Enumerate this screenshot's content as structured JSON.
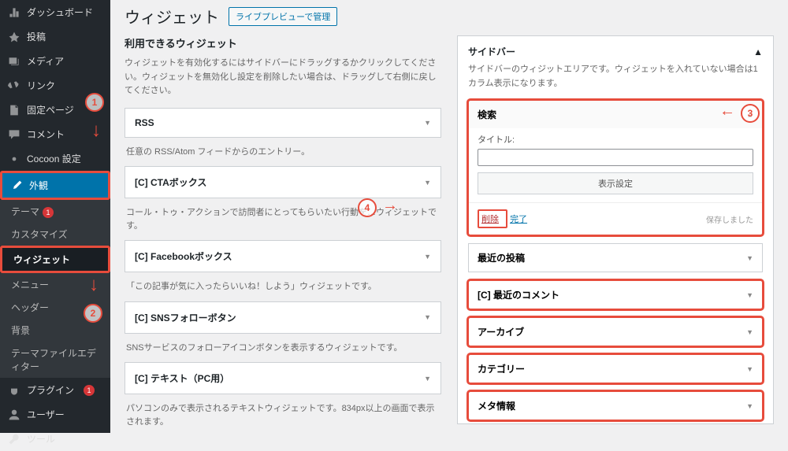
{
  "header": {
    "title": "ウィジェット",
    "liveBtn": "ライブプレビューで管理"
  },
  "sidebar": {
    "items": [
      {
        "label": "ダッシュボード",
        "icon": "dash"
      },
      {
        "label": "投稿",
        "icon": "pin"
      },
      {
        "label": "メディア",
        "icon": "media"
      },
      {
        "label": "リンク",
        "icon": "link"
      },
      {
        "label": "固定ページ",
        "icon": "page"
      },
      {
        "label": "コメント",
        "icon": "comment"
      },
      {
        "label": "Cocoon 設定",
        "icon": "gear"
      },
      {
        "label": "外観",
        "icon": "brush",
        "active": true
      },
      {
        "label": "プラグイン",
        "icon": "plug",
        "badge": "1"
      },
      {
        "label": "ユーザー",
        "icon": "user"
      },
      {
        "label": "ツール",
        "icon": "tool"
      }
    ],
    "appearanceSub": [
      {
        "label": "テーマ",
        "badge": "1"
      },
      {
        "label": "カスタマイズ"
      },
      {
        "label": "ウィジェット",
        "active": true
      },
      {
        "label": "メニュー"
      },
      {
        "label": "ヘッダー"
      },
      {
        "label": "背景"
      },
      {
        "label": "テーマファイルエディター"
      }
    ]
  },
  "available": {
    "heading": "利用できるウィジェット",
    "desc": "ウィジェットを有効化するにはサイドバーにドラッグするかクリックしてください。ウィジェットを無効化し設定を削除したい場合は、ドラッグして右側に戻してください。",
    "widgets": [
      {
        "title": "RSS",
        "desc": "任意の RSS/Atom フィードからのエントリー。"
      },
      {
        "title": "[C] CTAボックス",
        "desc": "コール・トゥ・アクションで訪問者にとってもらいたい行動を…ウィジェットです。"
      },
      {
        "title": "[C] Facebookボックス",
        "desc": "「この記事が気に入ったらいいね！しよう」ウィジェットです。"
      },
      {
        "title": "[C] SNSフォローボタン",
        "desc": "SNSサービスのフォローアイコンボタンを表示するウィジェットです。"
      },
      {
        "title": "[C] テキスト（PC用）",
        "desc": "パソコンのみで表示されるテキストウィジェットです。834px以上の画面で表示されます。"
      }
    ]
  },
  "sidebarArea": {
    "title": "サイドバー",
    "desc": "サイドバーのウィジットエリアです。ウィジェットを入れていない場合は1カラム表示になります。",
    "search": {
      "title": "検索",
      "titleLabel": "タイトル:",
      "dispBtn": "表示設定",
      "delete": "削除",
      "done": "完了",
      "saved": "保存しました"
    },
    "items": [
      {
        "title": "最近の投稿"
      },
      {
        "title": "[C] 最近のコメント",
        "hl": true
      },
      {
        "title": "アーカイブ",
        "hl": true
      },
      {
        "title": "カテゴリー",
        "hl": true
      },
      {
        "title": "メタ情報",
        "hl": true
      }
    ]
  },
  "annotations": {
    "1": "1",
    "2": "2",
    "3": "3",
    "4": "4"
  }
}
